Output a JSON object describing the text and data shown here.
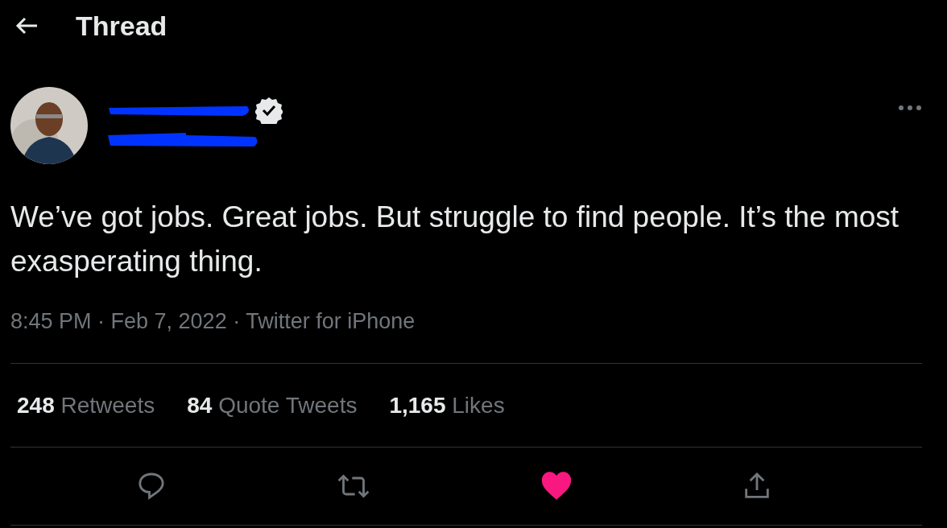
{
  "header": {
    "title": "Thread"
  },
  "tweet": {
    "verified": true,
    "name_redacted": true,
    "text": "We’ve got jobs. Great jobs. But struggle to find people. It’s the most exasperating thing.",
    "meta": "8:45 PM · Feb 7, 2022 · Twitter for iPhone",
    "stats": [
      {
        "count": "248",
        "label": "Retweets"
      },
      {
        "count": "84",
        "label": "Quote Tweets"
      },
      {
        "count": "1,165",
        "label": "Likes"
      }
    ],
    "liked": true
  }
}
